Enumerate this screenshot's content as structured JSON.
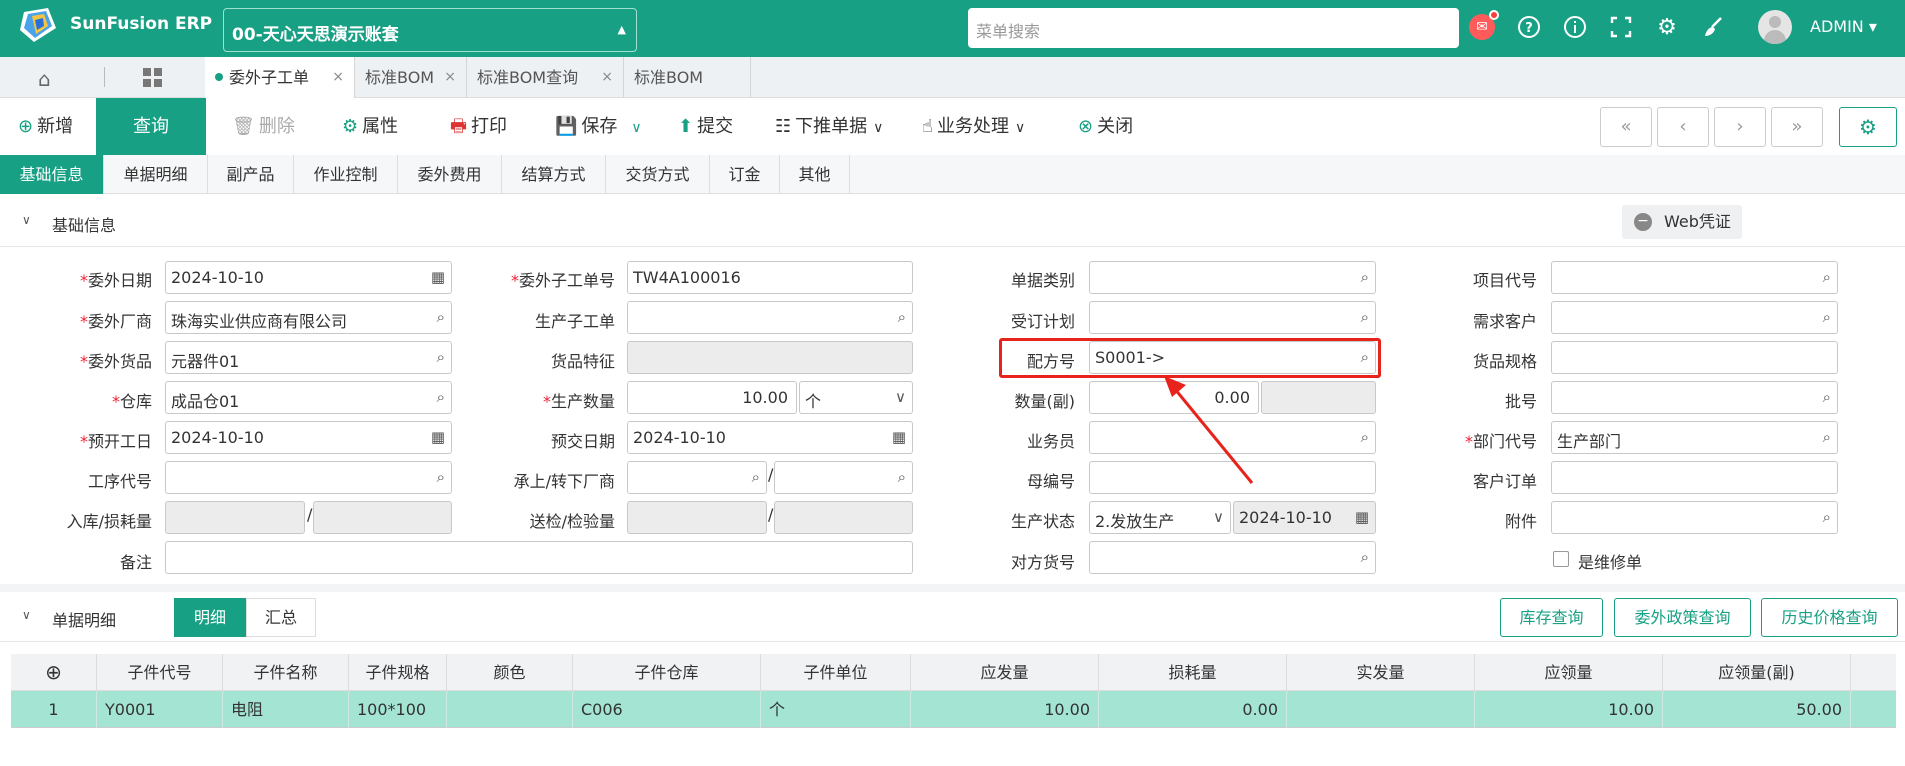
{
  "header": {
    "app_name": "SunFusion ERP",
    "account": "00-天心天思演示账套",
    "search_placeholder": "菜单搜索",
    "user": "ADMIN"
  },
  "tabs": [
    {
      "label": "委外子工单",
      "active": true
    },
    {
      "label": "标准BOM"
    },
    {
      "label": "标准BOM查询"
    },
    {
      "label": "标准BOM"
    }
  ],
  "toolbar": {
    "add": "新增",
    "query": "查询",
    "delete": "删除",
    "properties": "属性",
    "print": "打印",
    "save": "保存",
    "submit": "提交",
    "push_down": "下推单据",
    "business": "业务处理",
    "close": "关闭"
  },
  "subtabs": [
    "基础信息",
    "单据明细",
    "副产品",
    "作业控制",
    "委外费用",
    "结算方式",
    "交货方式",
    "订金",
    "其他"
  ],
  "section_basic": "基础信息",
  "web_voucher": "Web凭证",
  "form": {
    "wwrq": {
      "label": "委外日期",
      "value": "2024-10-10"
    },
    "wwcs": {
      "label": "委外厂商",
      "value": "珠海实业供应商有限公司"
    },
    "wwhp": {
      "label": "委外货品",
      "value": "元器件01"
    },
    "ck": {
      "label": "仓库",
      "value": "成品仓01"
    },
    "ykgr": {
      "label": "预开工日",
      "value": "2024-10-10"
    },
    "gxdh": {
      "label": "工序代号",
      "value": ""
    },
    "rk": {
      "label": "入库/损耗量"
    },
    "bz": {
      "label": "备注",
      "value": ""
    },
    "wwzgdh": {
      "label": "委外子工单号",
      "value": "TW4A100016"
    },
    "sczgd": {
      "label": "生产子工单",
      "value": ""
    },
    "hptz": {
      "label": "货品特征",
      "value": ""
    },
    "scsl": {
      "label": "生产数量",
      "value": "10.00",
      "unit": "个"
    },
    "yjrq": {
      "label": "预交日期",
      "value": "2024-10-10"
    },
    "cs": {
      "label": "承上/转下厂商"
    },
    "sj": {
      "label": "送检/检验量"
    },
    "djlb": {
      "label": "单据类别",
      "value": ""
    },
    "sdjh": {
      "label": "受订计划",
      "value": ""
    },
    "pfh": {
      "label": "配方号",
      "value": "S0001->"
    },
    "slf": {
      "label": "数量(副)",
      "value": "0.00"
    },
    "ywy": {
      "label": "业务员",
      "value": ""
    },
    "mbh": {
      "label": "母编号",
      "value": ""
    },
    "sczt": {
      "label": "生产状态",
      "value": "2.发放生产",
      "date": "2024-10-10"
    },
    "dfhh": {
      "label": "对方货号",
      "value": ""
    },
    "xmdh": {
      "label": "项目代号",
      "value": ""
    },
    "xqkh": {
      "label": "需求客户",
      "value": ""
    },
    "hpgg": {
      "label": "货品规格",
      "value": ""
    },
    "ph": {
      "label": "批号",
      "value": ""
    },
    "bmdh": {
      "label": "部门代号",
      "value": "生产部门"
    },
    "khdd": {
      "label": "客户订单",
      "value": ""
    },
    "fj": {
      "label": "附件",
      "value": ""
    },
    "swxd": {
      "label": "是维修单"
    }
  },
  "detail": {
    "title": "单据明细",
    "seg": [
      "明细",
      "汇总"
    ],
    "buttons": [
      "库存查询",
      "委外政策查询",
      "历史价格查询"
    ],
    "columns": [
      "子件代号",
      "子件名称",
      "子件规格",
      "颜色",
      "子件仓库",
      "子件单位",
      "应发量",
      "损耗量",
      "实发量",
      "应领量",
      "应领量(副)"
    ],
    "rows": [
      {
        "no": "1",
        "code": "Y0001",
        "name": "电阻",
        "spec": "100*100",
        "color": "",
        "wh": "C006",
        "unit": "个",
        "due": "10.00",
        "loss": "0.00",
        "actual": "",
        "req": "10.00",
        "req2": "50.00"
      }
    ]
  },
  "colors": {
    "brand": "#18a085",
    "highlight": "#e8231c"
  }
}
